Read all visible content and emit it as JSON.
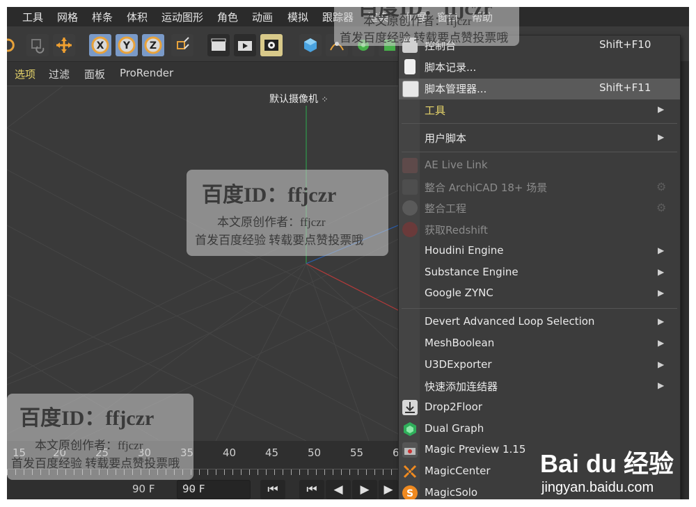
{
  "menubar": {
    "items": [
      "工具",
      "网格",
      "样条",
      "体积",
      "运动图形",
      "角色",
      "动画",
      "模拟",
      "跟踪器",
      "渲染",
      "扩展",
      "窗口",
      "帮助"
    ]
  },
  "viewport_menu": {
    "items": [
      "选项",
      "过滤",
      "面板",
      "ProRender"
    ]
  },
  "viewport": {
    "camera_label": "默认摄像机"
  },
  "timeline": {
    "ticks": [
      "15",
      "20",
      "25",
      "30",
      "35",
      "40",
      "45",
      "50",
      "55",
      "6"
    ],
    "frame_end_a": "90 F",
    "frame_end_b": "90 F"
  },
  "dropdown": {
    "items": [
      {
        "label": "控制台",
        "shortcut": "Shift+F10",
        "icon": "console-icon"
      },
      {
        "label": "脚本记录...",
        "icon": "script-log-icon"
      },
      {
        "label": "脚本管理器...",
        "shortcut": "Shift+F11",
        "icon": "script-manager-icon",
        "highlighted": true
      },
      {
        "label": "工具",
        "submenu": true,
        "style": "yellow"
      },
      {
        "label": "用户脚本",
        "submenu": true
      },
      {
        "label": "AE Live Link",
        "disabled": true,
        "icon": "ae-icon"
      },
      {
        "label": "整合 ArchiCAD 18+ 场景",
        "disabled": true,
        "icon": "archicad-icon"
      },
      {
        "label": "整合工程",
        "disabled": true,
        "icon": "project-icon"
      },
      {
        "label": "获取Redshift",
        "disabled": true,
        "icon": "redshift-icon"
      },
      {
        "label": "Houdini Engine",
        "submenu": true
      },
      {
        "label": "Substance Engine",
        "submenu": true
      },
      {
        "label": "Google ZYNC",
        "submenu": true
      },
      {
        "label": "Devert Advanced Loop Selection",
        "submenu": true
      },
      {
        "label": "MeshBoolean",
        "submenu": true
      },
      {
        "label": "U3DExporter",
        "submenu": true
      },
      {
        "label": "快速添加连结器",
        "submenu": true
      },
      {
        "label": "Drop2Floor",
        "icon": "drop2floor-icon"
      },
      {
        "label": "Dual Graph",
        "icon": "dual-graph-icon"
      },
      {
        "label": "Magic Preview 1.15",
        "icon": "magic-preview-icon"
      },
      {
        "label": "MagicCenter",
        "icon": "magic-center-icon"
      },
      {
        "label": "MagicSolo",
        "icon": "magic-solo-icon"
      }
    ]
  },
  "watermark": {
    "title": "百度ID：ffjczr",
    "line1": "本文原创作者：ffjczr",
    "line2": "首发百度经验 转载要点赞投票哦"
  },
  "baidu": {
    "logo_text": "Bai du 经验",
    "url": "jingyan.baidu.com"
  },
  "colors": {
    "accent_yellow": "#e7d56a",
    "highlight_row": "#5a5a5a",
    "axis_green": "#2f9a4a",
    "axis_red": "#b53a3a"
  }
}
